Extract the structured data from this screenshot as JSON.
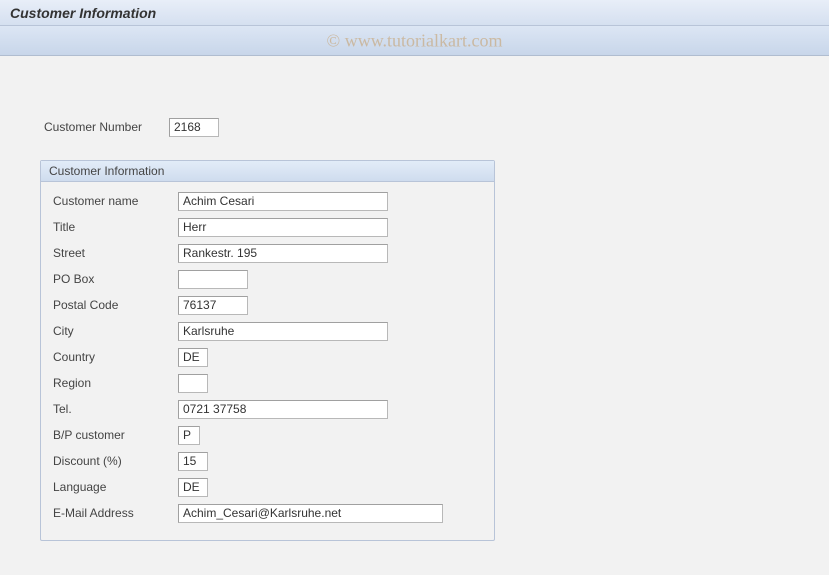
{
  "header": {
    "title": "Customer Information"
  },
  "watermark": "© www.tutorialkart.com",
  "customer_number": {
    "label": "Customer Number",
    "value": "2168"
  },
  "group": {
    "title": "Customer Information",
    "fields": {
      "name": {
        "label": "Customer name",
        "value": "Achim Cesari"
      },
      "title": {
        "label": "Title",
        "value": "Herr"
      },
      "street": {
        "label": "Street",
        "value": "Rankestr. 195"
      },
      "pobox": {
        "label": "PO Box",
        "value": ""
      },
      "postal": {
        "label": "Postal Code",
        "value": "76137"
      },
      "city": {
        "label": "City",
        "value": "Karlsruhe"
      },
      "country": {
        "label": "Country",
        "value": "DE"
      },
      "region": {
        "label": "Region",
        "value": ""
      },
      "tel": {
        "label": "Tel.",
        "value": "0721 37758"
      },
      "bp": {
        "label": "B/P customer",
        "value": "P"
      },
      "discount": {
        "label": "Discount (%)",
        "value": "15"
      },
      "language": {
        "label": "Language",
        "value": "DE"
      },
      "email": {
        "label": "E-Mail Address",
        "value": "Achim_Cesari@Karlsruhe.net"
      }
    }
  }
}
